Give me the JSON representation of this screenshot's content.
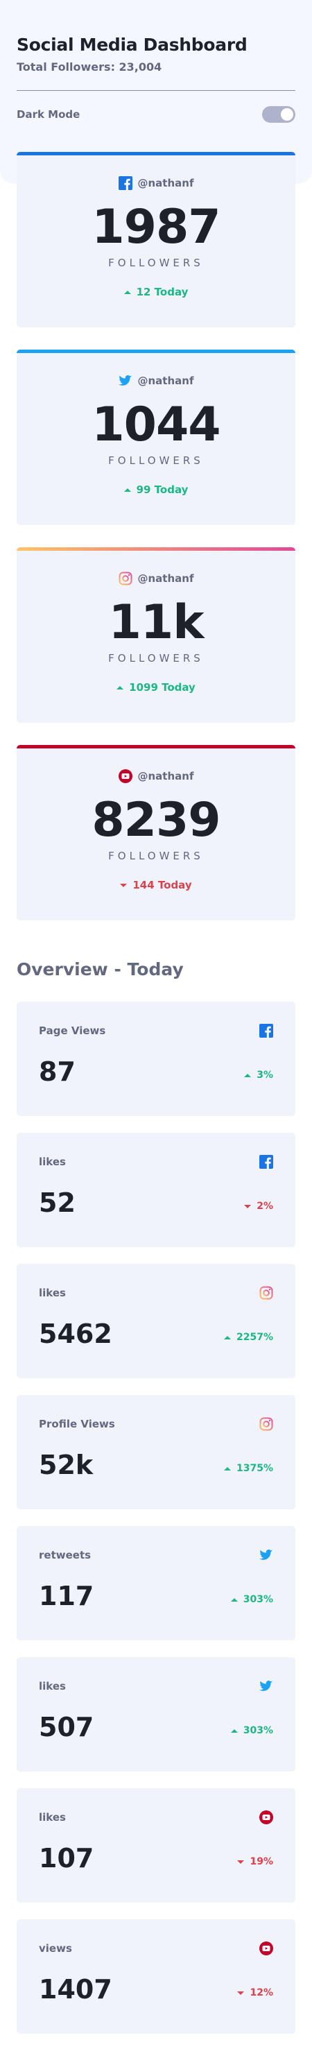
{
  "header": {
    "title": "Social Media Dashboard",
    "total_followers": "Total Followers: 23,004"
  },
  "toggle": {
    "label": "Dark Mode",
    "state": "off"
  },
  "follower_cards": [
    {
      "network": "facebook",
      "icon": "facebook-icon",
      "handle": "@nathanf",
      "count": "1987",
      "label": "FOLLOWERS",
      "today": "12 Today",
      "trend": "up",
      "accent": "#1b74e4"
    },
    {
      "network": "twitter",
      "icon": "twitter-icon",
      "handle": "@nathanf",
      "count": "1044",
      "label": "FOLLOWERS",
      "today": "99 Today",
      "trend": "up",
      "accent": "#1da1f2"
    },
    {
      "network": "instagram",
      "icon": "instagram-icon",
      "handle": "@nathanf",
      "count": "11k",
      "label": "FOLLOWERS",
      "today": "1099 Today",
      "trend": "up",
      "accent": "#df8f6e"
    },
    {
      "network": "youtube",
      "icon": "youtube-icon",
      "handle": "@nathanf",
      "count": "8239",
      "label": "FOLLOWERS",
      "today": "144 Today",
      "trend": "down",
      "accent": "#c4032a"
    }
  ],
  "overview": {
    "title": "Overview - Today",
    "cards": [
      {
        "metric": "Page Views",
        "icon": "facebook-icon",
        "value": "87",
        "pct": "3%",
        "trend": "up"
      },
      {
        "metric": "likes",
        "icon": "facebook-icon",
        "value": "52",
        "pct": "2%",
        "trend": "down"
      },
      {
        "metric": "likes",
        "icon": "instagram-icon",
        "value": "5462",
        "pct": "2257%",
        "trend": "up"
      },
      {
        "metric": "Profile Views",
        "icon": "instagram-icon",
        "value": "52k",
        "pct": "1375%",
        "trend": "up"
      },
      {
        "metric": "retweets",
        "icon": "twitter-icon",
        "value": "117",
        "pct": "303%",
        "trend": "up"
      },
      {
        "metric": "likes",
        "icon": "twitter-icon",
        "value": "507",
        "pct": "303%",
        "trend": "up"
      },
      {
        "metric": "likes",
        "icon": "youtube-icon",
        "value": "107",
        "pct": "19%",
        "trend": "down"
      },
      {
        "metric": "views",
        "icon": "youtube-icon",
        "value": "1407",
        "pct": "12%",
        "trend": "down"
      }
    ]
  },
  "colors": {
    "up": "#1eb589",
    "down": "#dc414c",
    "facebook": "#1b74e4",
    "twitter": "#1da1f2",
    "instagram_from": "#fdc468",
    "instagram_to": "#c13584",
    "youtube": "#c4032a"
  }
}
